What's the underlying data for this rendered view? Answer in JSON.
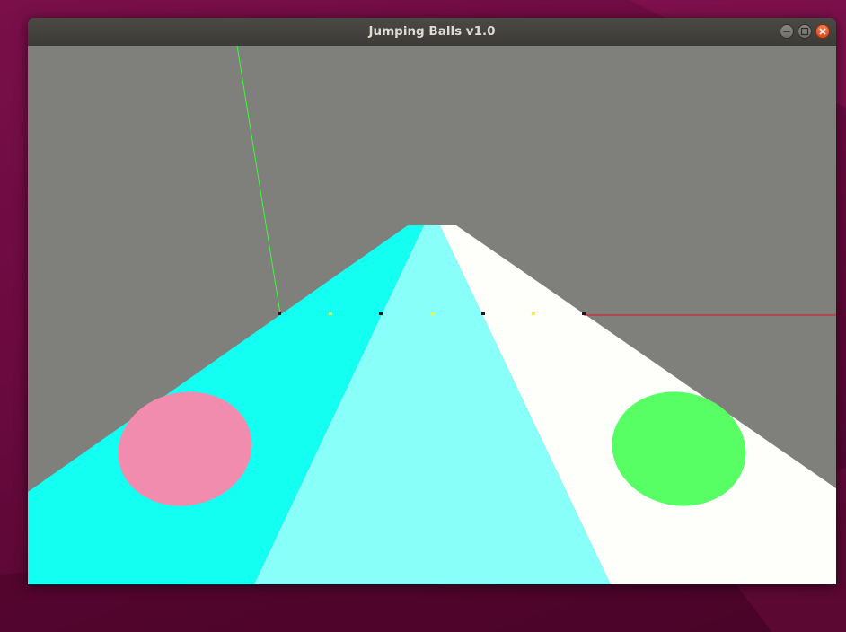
{
  "window": {
    "title": "Jumping Balls v1.0",
    "controls": [
      "minimize-icon",
      "maximize-icon",
      "close-icon"
    ]
  },
  "scene": {
    "colors": {
      "sky": "#7f7f7b",
      "lane_left": "#13fff2",
      "lane_center": "#89fffa",
      "lane_right": "#fefefa",
      "ball_pink": "#f28cae",
      "ball_green": "#58ff64",
      "guide_green": "#33ff33",
      "guide_red": "#e0102a",
      "marker_dark": "#1a1a1a",
      "marker_yellow": "#f2f240"
    },
    "balls": [
      {
        "name": "pink-ball",
        "lane": "left"
      },
      {
        "name": "green-ball",
        "lane": "right"
      }
    ],
    "lanes": [
      "left",
      "center",
      "right"
    ]
  }
}
